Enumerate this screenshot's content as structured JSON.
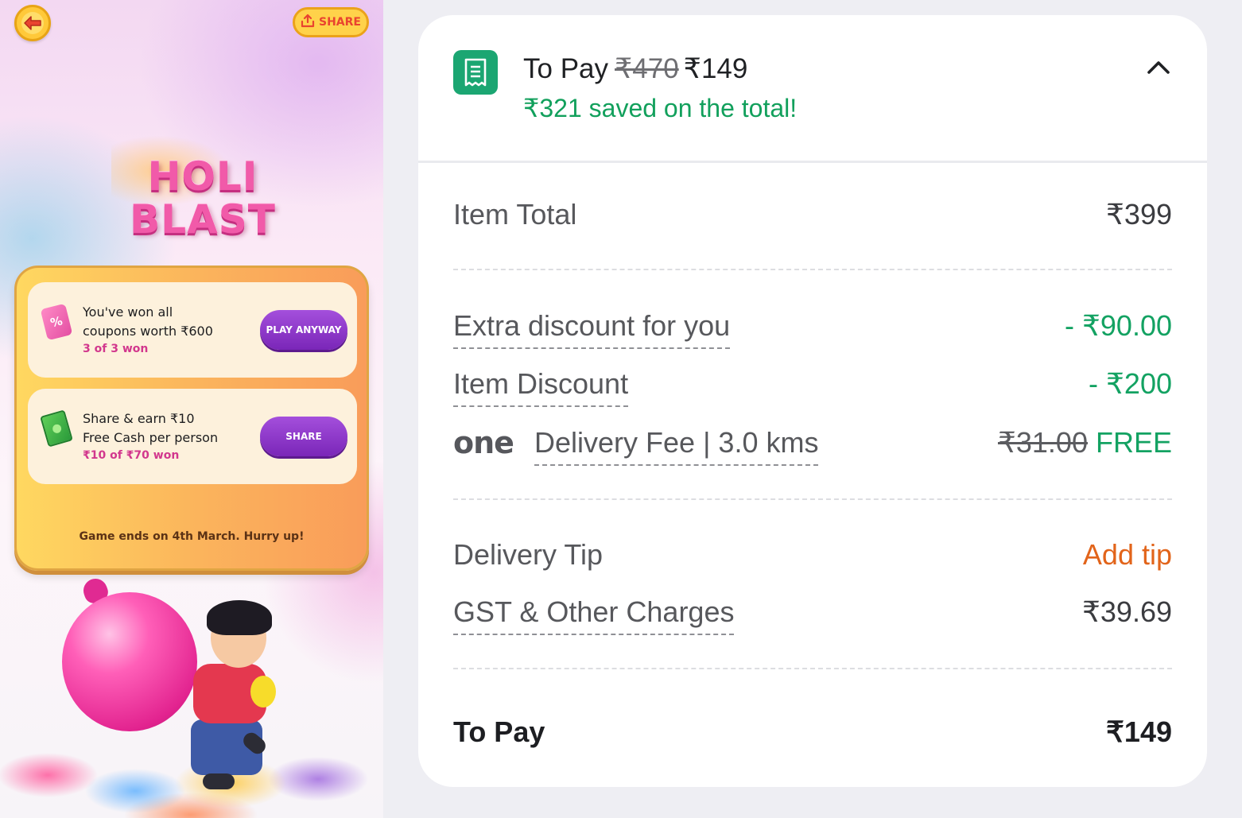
{
  "game": {
    "share_top_label": "SHARE",
    "title_line1": "HOLI",
    "title_line2": "BLAST",
    "rewards": [
      {
        "line1": "You've won all",
        "line2": "coupons worth ₹600",
        "progress": "3 of 3 won",
        "button": "PLAY ANYWAY",
        "icon": "coupon-icon"
      },
      {
        "line1": "Share & earn ₹10",
        "line2": "Free Cash per person",
        "progress": "₹10 of ₹70 won",
        "button": "SHARE",
        "icon": "cash-icon"
      }
    ],
    "footer_note": "Game ends on 4th March. Hurry up!"
  },
  "bill": {
    "header": {
      "to_pay_label": "To Pay",
      "original_price": "₹470",
      "final_price": "₹149",
      "saved_text": "₹321 saved on the total!",
      "icon": "receipt-icon"
    },
    "item_total": {
      "label": "Item Total",
      "value": "₹399"
    },
    "extra_discount": {
      "label": "Extra discount for you",
      "value": "- ₹90.00"
    },
    "item_discount": {
      "label": "Item Discount",
      "value": "- ₹200"
    },
    "delivery_fee": {
      "brand": "one",
      "label": "Delivery Fee | 3.0 kms",
      "old_value": "₹31.00",
      "value": "FREE"
    },
    "delivery_tip": {
      "label": "Delivery Tip",
      "action": "Add tip"
    },
    "gst": {
      "label": "GST & Other Charges",
      "value": "₹39.69"
    },
    "to_pay": {
      "label": "To Pay",
      "value": "₹149"
    }
  },
  "colors": {
    "green": "#13a262",
    "orange": "#e2641a",
    "purple": "#7a26b8",
    "gold": "#ffc93a"
  }
}
